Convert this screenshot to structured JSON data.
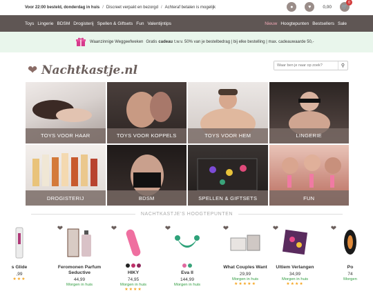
{
  "topbar": {
    "delivery_bold": "Voor 22:00 besteld, donderdag in huis",
    "usp2": "Discreet verpakt en bezorgd",
    "usp3": "Achteraf betalen is mogelijk",
    "cart_total": "0,00",
    "cart_count": "0"
  },
  "nav": {
    "left": [
      "Toys",
      "Lingerie",
      "BDSM",
      "Drogisterij",
      "Spellen & Giftsets",
      "Fun",
      "Valentijntips"
    ],
    "right": [
      "Nieuw",
      "Hoogtepunten",
      "Bestsellers",
      "Sale"
    ]
  },
  "promo": {
    "lead": "Waanzinnige Weggeefweken",
    "mid": "Gratis",
    "bold": "cadeau",
    "rest": "t.w.v. 50% van je bestelbedrag | bij elke bestelling | max. cadeauwaarde 50,-"
  },
  "logo": {
    "text": "Nachtkastje.nl"
  },
  "search": {
    "placeholder": "Waar ben je naar op zoek?"
  },
  "categories": [
    {
      "label": "TOYS VOOR HAAR"
    },
    {
      "label": "TOYS VOOR KOPPELS"
    },
    {
      "label": "TOYS VOOR HEM"
    },
    {
      "label": "LINGERIE"
    },
    {
      "label": "DROGISTERIJ"
    },
    {
      "label": "BDSM"
    },
    {
      "label": "SPELLEN & GIFTSETS"
    },
    {
      "label": "FUN"
    }
  ],
  "section": {
    "title": "NACHTKASTJE'S HOOGTEPUNTEN"
  },
  "products": [
    {
      "name": "s Glide",
      "price": ",99",
      "shipping": "",
      "stars": "★★★"
    },
    {
      "name": "Feromonen Parfum Seductive",
      "price": "44,99",
      "shipping": "Morgen in huis",
      "stars": ""
    },
    {
      "name": "HIKY",
      "price": "74,95",
      "shipping": "Morgen in huis",
      "stars": "★★★★",
      "colors": [
        "#222222",
        "#c0306a",
        "#8e2a5c"
      ]
    },
    {
      "name": "Eva II",
      "price": "144,99",
      "shipping": "Morgen in huis",
      "stars": "",
      "colors": [
        "#e06aa0",
        "#3aa37a"
      ]
    },
    {
      "name": "What Couples Want",
      "price": "29,99",
      "shipping": "Morgen in huis",
      "stars": "★★★★★"
    },
    {
      "name": "Ultiem Verlangen",
      "price": "34,99",
      "shipping": "Morgen in huis",
      "stars": "★★★★"
    },
    {
      "name": "Po",
      "price": "74",
      "shipping": "Morgen",
      "stars": ""
    }
  ],
  "colors": {
    "nav_bg": "#5f5654",
    "accent_pink": "#f2a9b7",
    "ship_green": "#2e9b3e",
    "star": "#f5a623"
  }
}
